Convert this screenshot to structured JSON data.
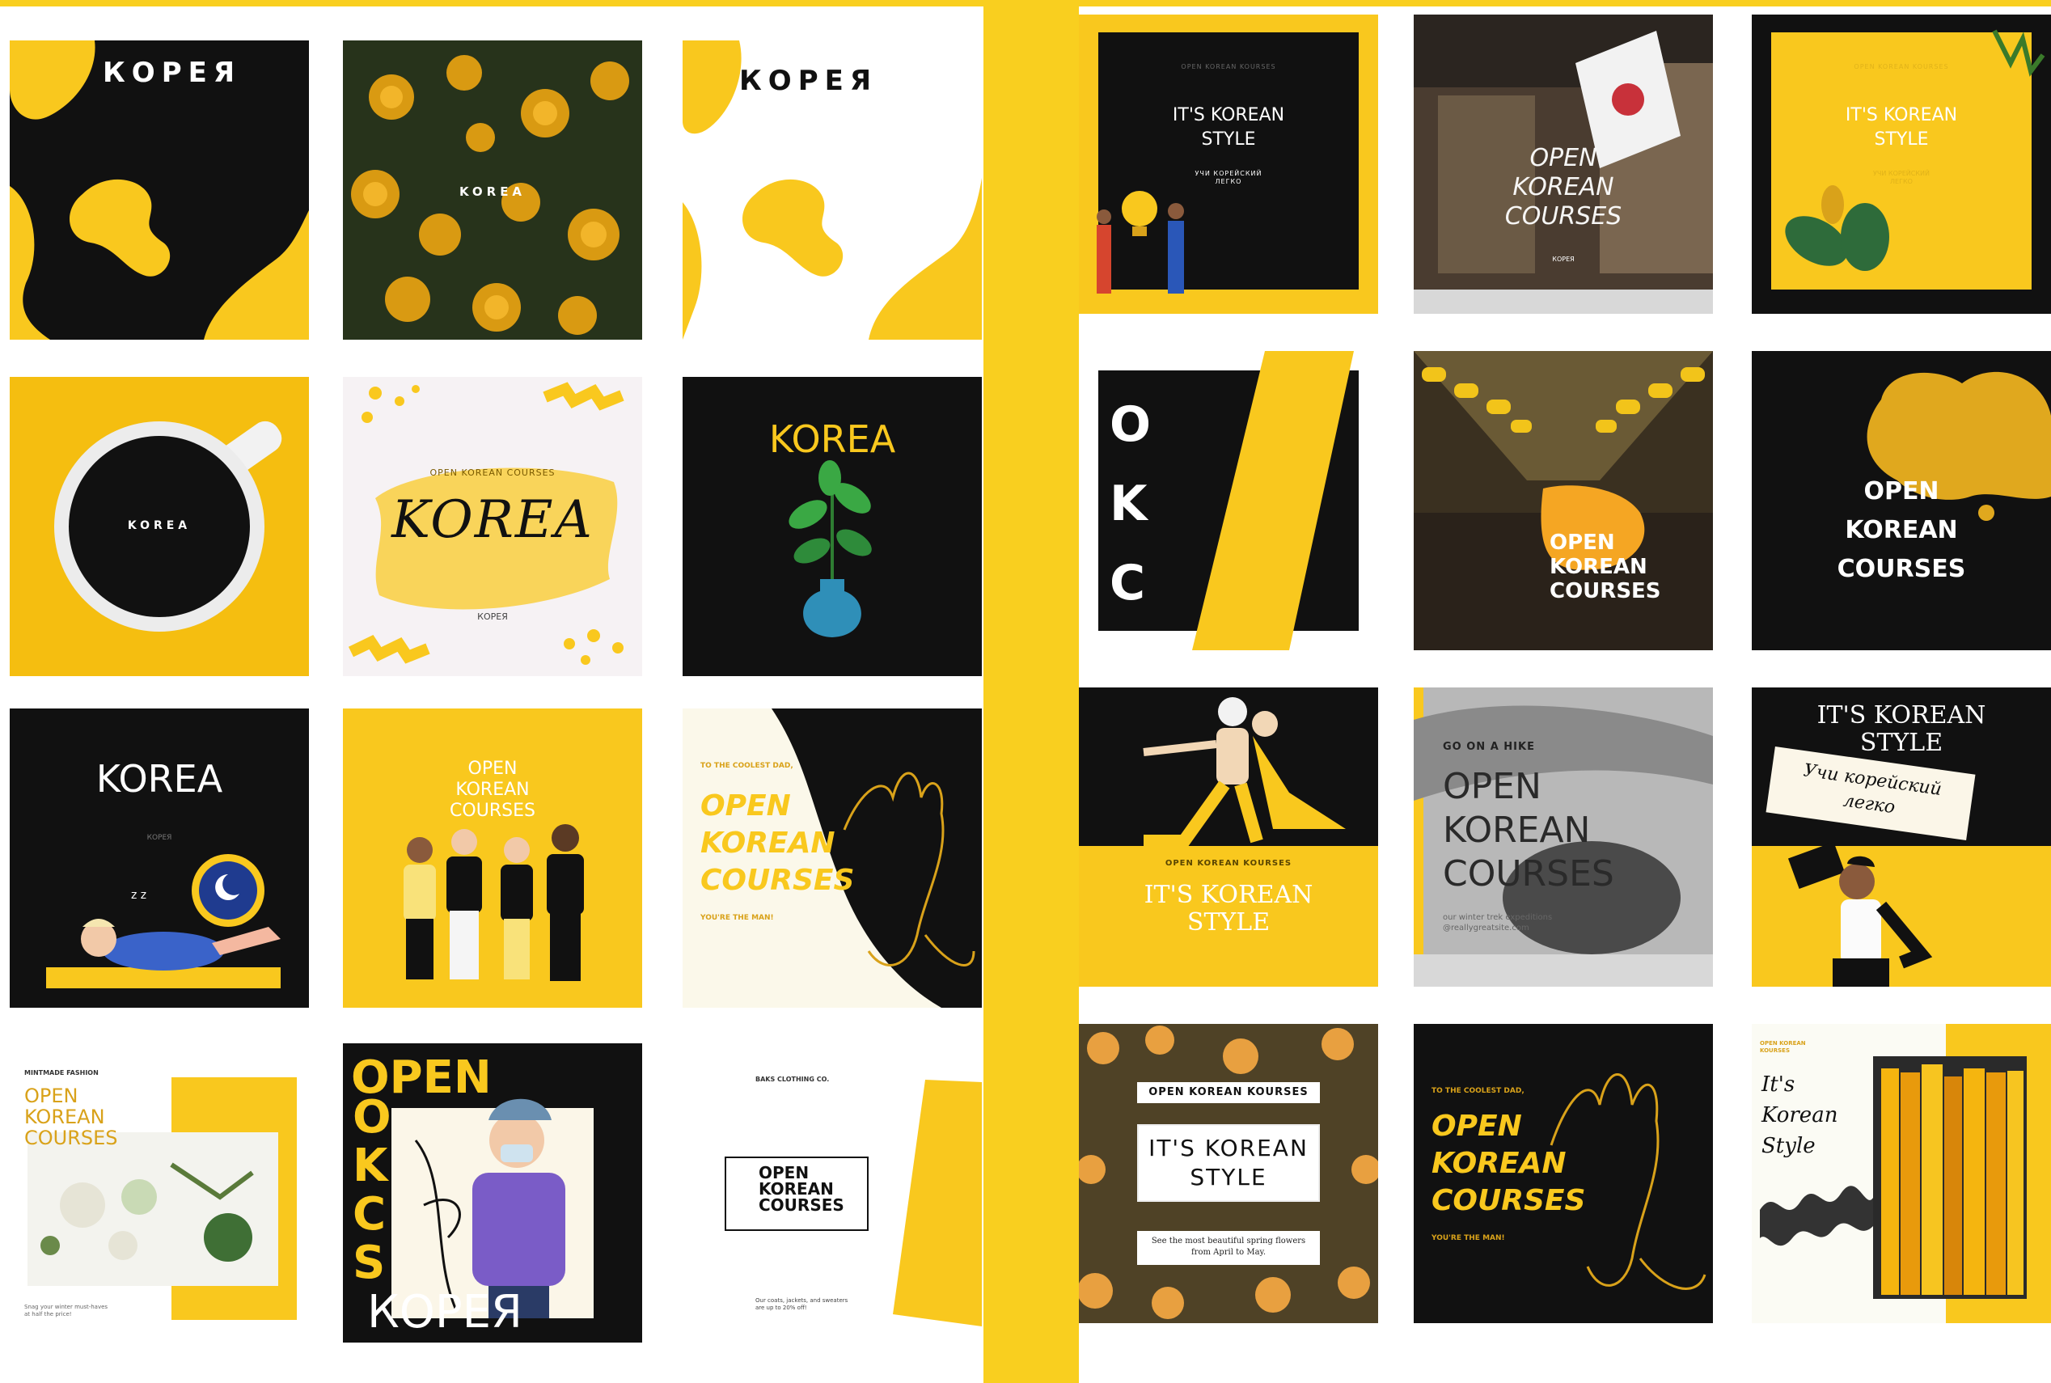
{
  "colors": {
    "accent_yellow": "#f9c81e",
    "black": "#111111",
    "white": "#ffffff",
    "cream": "#fbf6e8"
  },
  "left": {
    "t1": {
      "title": "КОРЕЯ"
    },
    "t2": {
      "title": "KOREA"
    },
    "t3": {
      "title": "КОРЕЯ"
    },
    "t4": {
      "title": "KOREA"
    },
    "t5": {
      "subtitle": "OPEN KOREAN COURSES",
      "title": "KOREA",
      "footer": "КОРЕЯ"
    },
    "t6": {
      "title": "KOREA"
    },
    "t7": {
      "title": "KOREA",
      "small": "КОРЕЯ"
    },
    "t8": {
      "line1": "OPEN",
      "line2": "KOREAN",
      "line3": "COURSES"
    },
    "t9": {
      "top": "TO THE COOLEST DAD,",
      "line1": "OPEN",
      "line2": "KOREAN",
      "line3": "COURSES",
      "bottom": "YOU'RE THE MAN!"
    },
    "t10": {
      "brand": "MINTMADE FASHION",
      "line1": "OPEN",
      "line2": "KOREAN",
      "line3": "COURSES",
      "bottom1": "Snag your winter must-haves",
      "bottom2": "at half the price!"
    },
    "t11": {
      "top": "OPEN",
      "vertical": "OKCS",
      "bottom": "КОРЕЯ"
    },
    "t12": {
      "brand": "BAKS CLOTHING CO.",
      "line1": "OPEN",
      "line2": "KOREAN",
      "line3": "COURSES",
      "bottom1": "Our coats, jackets, and sweaters",
      "bottom2": "are up to 20% off!"
    }
  },
  "right": {
    "r1": {
      "top": "OPEN KOREAN KOURSES",
      "line1": "IT'S KOREAN",
      "line2": "STYLE",
      "sub1": "УЧИ КОРЕЙСКИЙ",
      "sub2": "ЛЕГКО"
    },
    "r2": {
      "line1": "OPEN",
      "line2": "KOREAN",
      "line3": "COURSES",
      "small": "КОРЕЯ"
    },
    "r3": {
      "top": "OPEN KOREAN KOURSES",
      "line1": "IT'S KOREAN",
      "line2": "STYLE",
      "sub1": "УЧИ КОРЕЙСКИЙ",
      "sub2": "ЛЕГКО"
    },
    "r4": {
      "l1": "O",
      "l2": "K",
      "l3": "C"
    },
    "r5": {
      "line1": "OPEN",
      "line2": "KOREAN",
      "line3": "COURSES"
    },
    "r6": {
      "line1": "OPEN",
      "line2": "KOREAN",
      "line3": "COURSES"
    },
    "r7": {
      "top": "OPEN KOREAN KOURSES",
      "line1": "IT'S KOREAN",
      "line2": "STYLE"
    },
    "r8": {
      "top": "GO ON A HIKE",
      "line1": "OPEN",
      "line2": "KOREAN",
      "line3": "COURSES",
      "small1": "our winter trek expeditions",
      "small2": "@reallygreatsite.com"
    },
    "r9": {
      "line1": "IT'S KOREAN",
      "line2": "STYLE",
      "card1": "Учи корейский",
      "card2": "легко"
    },
    "r10": {
      "top": "OPEN KOREAN KOURSES",
      "line1": "IT'S KOREAN",
      "line2": "STYLE",
      "bottom1": "See the most beautiful spring flowers",
      "bottom2": "from April to May."
    },
    "r11": {
      "top": "TO THE COOLEST DAD,",
      "line1": "OPEN",
      "line2": "KOREAN",
      "line3": "COURSES",
      "bottom": "YOU'RE THE MAN!"
    },
    "r12": {
      "top1": "OPEN KOREAN",
      "top2": "KOURSES",
      "line1": "It's",
      "line2": "Korean",
      "line3": "Style"
    }
  }
}
